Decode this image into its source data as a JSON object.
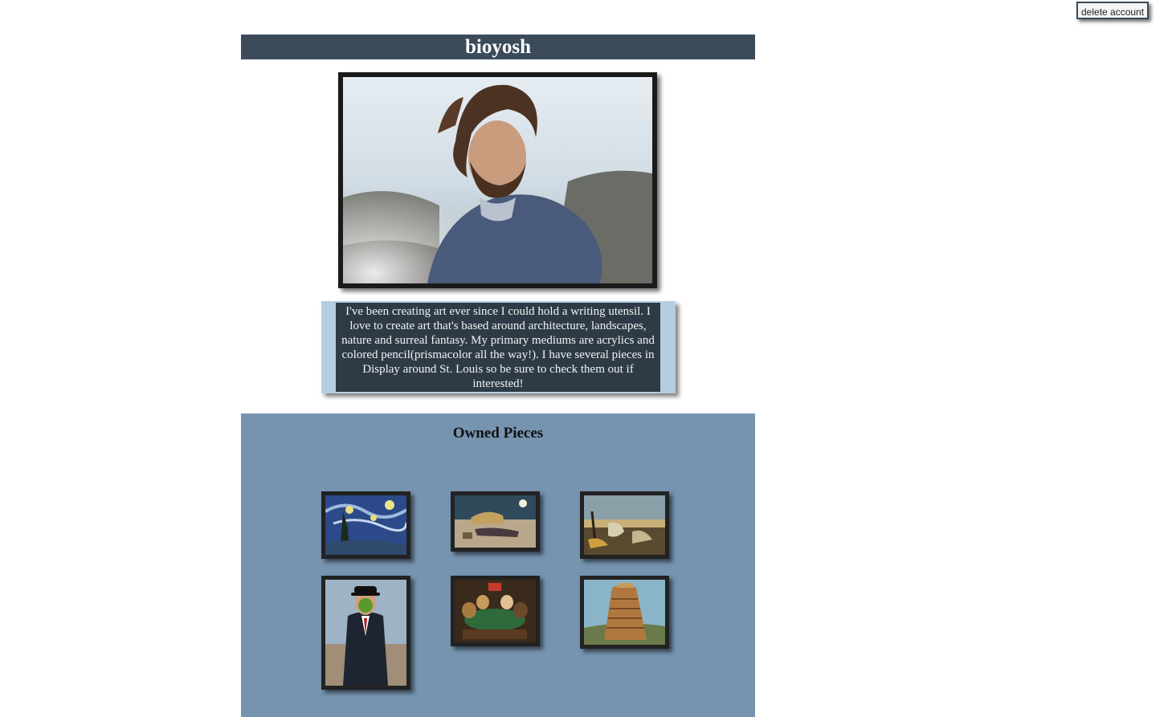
{
  "header": {
    "delete_label": "delete account",
    "username": "bioyosh"
  },
  "profile": {
    "photo_alt": "profile-photo",
    "bio": "I've been creating art ever since I could hold a writing utensil. I love to create art that's based around architecture, landscapes, nature and surreal fantasy. My primary mediums are acrylics and colored pencil(prismacolor all the way!). I have several pieces in Display around St. Louis so be sure to check them out if interested!"
  },
  "owned": {
    "heading": "Owned Pieces",
    "pieces": [
      {
        "id": "starry-night"
      },
      {
        "id": "sleeping-gypsy"
      },
      {
        "id": "persistence-of-memory"
      },
      {
        "id": "son-of-man"
      },
      {
        "id": "dogs-playing-poker"
      },
      {
        "id": "tower-of-babel"
      }
    ]
  },
  "colors": {
    "title_bar": "#3b4b5a",
    "bio_border": "#b6cde0",
    "bio_bg": "#2e3b47",
    "owned_bg": "#7694b0"
  }
}
